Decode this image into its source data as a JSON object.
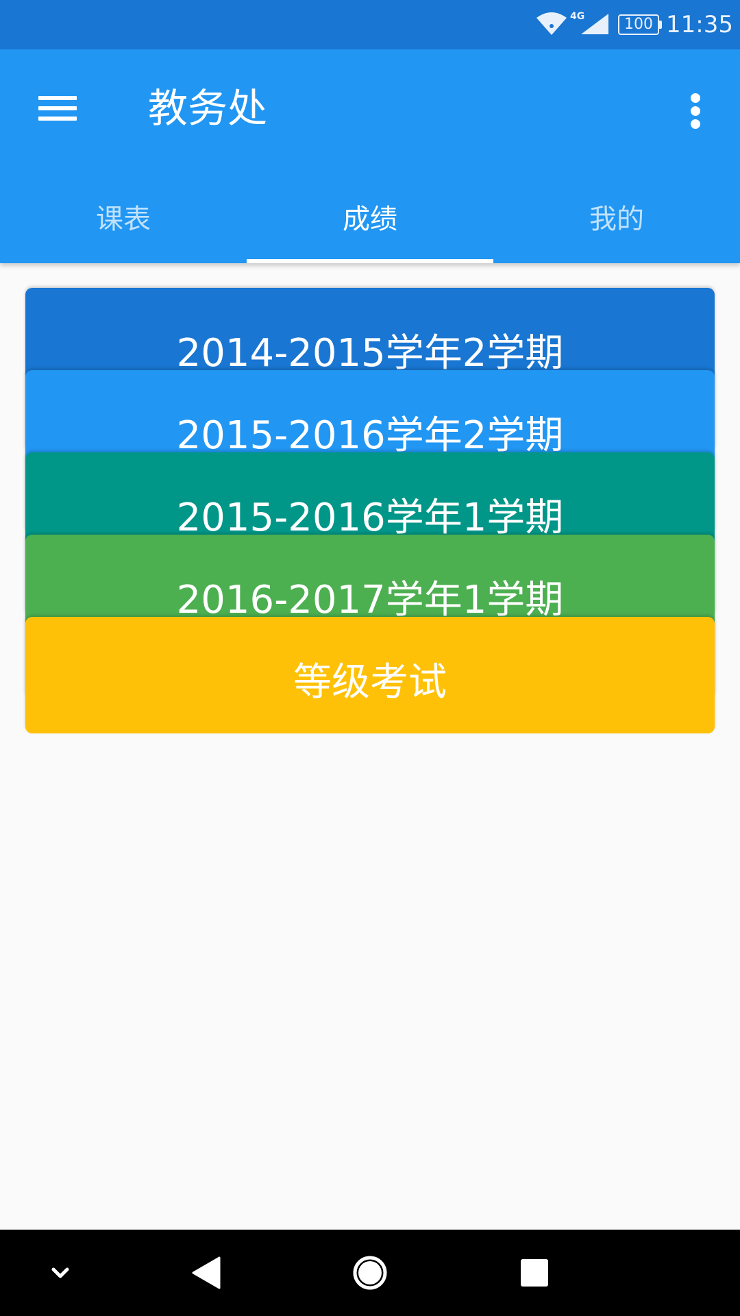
{
  "status_bar": {
    "network_label": "4G",
    "battery_level": "100",
    "time": "11:35",
    "icons": [
      "wifi-icon",
      "cell-signal-icon",
      "battery-icon"
    ]
  },
  "app_bar": {
    "title": "教务处",
    "menu_icon": "hamburger-menu-icon",
    "overflow_icon": "more-vert-icon"
  },
  "tabs": [
    {
      "label": "课表",
      "active": false
    },
    {
      "label": "成绩",
      "active": true
    },
    {
      "label": "我的",
      "active": false
    }
  ],
  "terms": [
    {
      "label": "2014-2015学年2学期",
      "color": "#1976d2"
    },
    {
      "label": "2015-2016学年2学期",
      "color": "#2196f3"
    },
    {
      "label": "2015-2016学年1学期",
      "color": "#009688"
    },
    {
      "label": "2016-2017学年1学期",
      "color": "#4caf50"
    },
    {
      "label": "等级考试",
      "color": "#ffc107"
    }
  ],
  "nav_bar": {
    "icons": [
      "collapse-chevron-icon",
      "back-icon",
      "home-icon",
      "recents-icon"
    ]
  },
  "colors": {
    "status_bar": "#1976d2",
    "app_bar": "#2196f3",
    "background": "#fafafa",
    "nav_bar": "#000000"
  }
}
